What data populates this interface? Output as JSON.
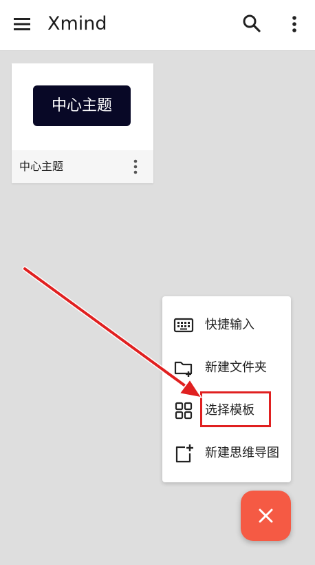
{
  "app_bar": {
    "title": "Xmind",
    "icons": [
      "menu-icon",
      "search-icon",
      "more-vert-icon"
    ]
  },
  "map_card": {
    "central_topic": "中心主题",
    "name": "中心主题",
    "topic_color": "#080826"
  },
  "popup_menu": {
    "items": [
      {
        "label": "快捷输入",
        "icon": "keyboard-icon"
      },
      {
        "label": "新建文件夹",
        "icon": "new-folder-icon"
      },
      {
        "label": "选择模板",
        "icon": "grid-template-icon"
      },
      {
        "label": "新建思维导图",
        "icon": "new-mindmap-icon"
      }
    ],
    "highlighted_item": "选择模板"
  },
  "fab": {
    "icon": "close-icon",
    "color": "#f55a44"
  },
  "annotation": {
    "arrow_color": "#e02020",
    "highlight_color": "#e02020"
  }
}
